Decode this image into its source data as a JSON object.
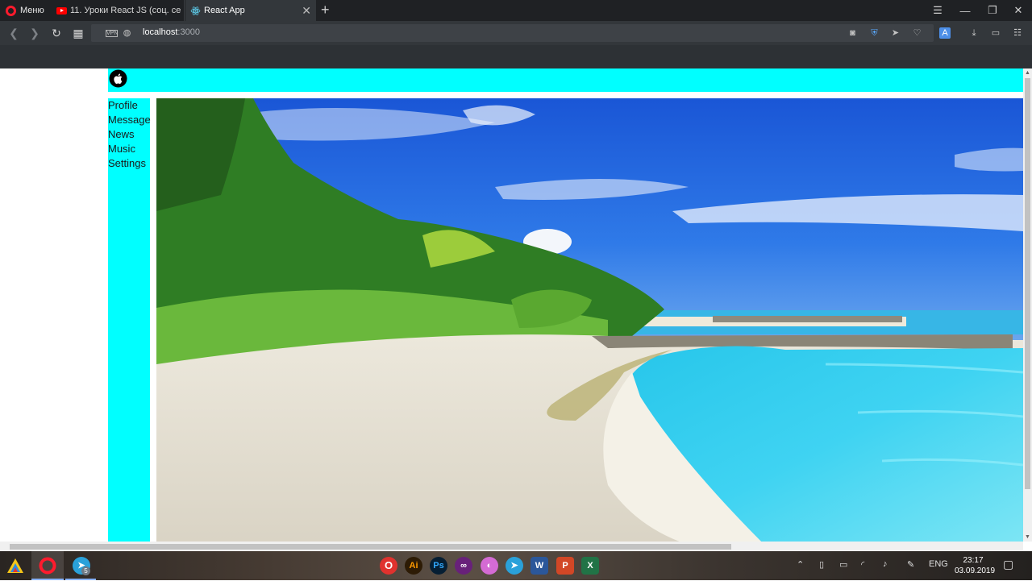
{
  "browser": {
    "menu_label": "Меню",
    "tabs": [
      {
        "title": "11. Уроки React JS (соц. се",
        "active": false
      },
      {
        "title": "React App",
        "active": true
      }
    ],
    "url_host": "localhost",
    "url_port": ":3000"
  },
  "page": {
    "header_color": "#00ffff",
    "nav": {
      "items": [
        {
          "label": "Profile"
        },
        {
          "label": "Message"
        },
        {
          "label": "News"
        },
        {
          "label": "Music"
        },
        {
          "label": "Settings"
        }
      ]
    }
  },
  "taskbar": {
    "apps": [
      "Opera",
      "Telegram",
      "Adobe Illustrator",
      "Adobe Photoshop",
      "Visual Studio",
      "Word",
      "PowerPoint",
      "Excel"
    ],
    "telegram_badge": "5",
    "language": "ENG",
    "time": "23:17",
    "date": "03.09.2019"
  }
}
